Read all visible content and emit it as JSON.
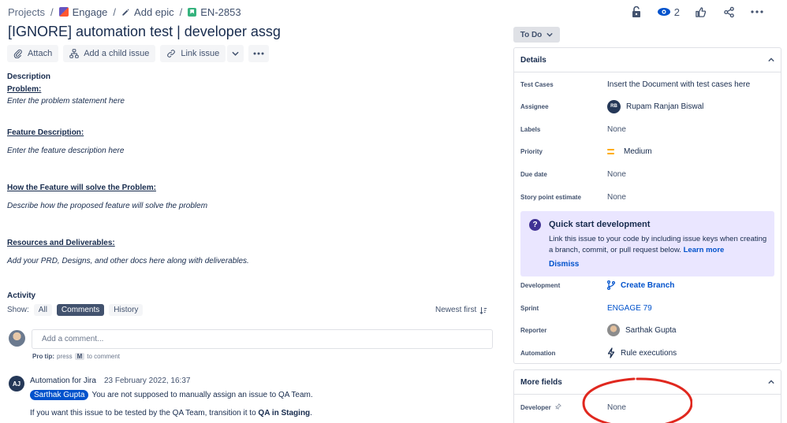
{
  "breadcrumb": {
    "projects": "Projects",
    "project": "Engage",
    "epic": "Add epic",
    "issue_key": "EN-2853"
  },
  "top": {
    "watchers": "2"
  },
  "issue": {
    "title": "[IGNORE] automation test | developer assg"
  },
  "toolbar": {
    "attach": "Attach",
    "add_child": "Add a child issue",
    "link_issue": "Link issue"
  },
  "description": {
    "heading": "Description",
    "sections": [
      {
        "title": "Problem:",
        "body": "Enter the problem statement here"
      },
      {
        "title": "Feature Description:",
        "body": "Enter the feature description here"
      },
      {
        "title": "How the Feature will solve the Problem:",
        "body": "Describe how the proposed feature will solve the problem"
      },
      {
        "title": "Resources and Deliverables:",
        "body": "Add your PRD, Designs, and other docs here along with deliverables."
      }
    ]
  },
  "activity": {
    "title": "Activity",
    "show_label": "Show:",
    "tabs": [
      "All",
      "Comments",
      "History"
    ],
    "sort": "Newest first",
    "add_comment_placeholder": "Add a comment...",
    "protip_prefix": "Pro tip:",
    "protip_press": "press",
    "protip_key": "M",
    "protip_suffix": "to comment"
  },
  "comment": {
    "avatar_initials": "AJ",
    "author": "Automation for Jira",
    "timestamp": "23 February 2022, 16:37",
    "mention": "Sarthak Gupta",
    "line1": "You are not supposed to manually assign an issue to QA Team.",
    "line2_prefix": "If you want this issue to be tested by the QA Team, transition it to ",
    "line2_bold": "QA in Staging",
    "line2_suffix": "."
  },
  "status": {
    "label": "To Do"
  },
  "details": {
    "title": "Details",
    "fields": {
      "test_cases": {
        "label": "Test Cases",
        "value": "Insert the Document with test cases here"
      },
      "assignee": {
        "label": "Assignee",
        "initials": "RB",
        "value": "Rupam Ranjan Biswal"
      },
      "labels": {
        "label": "Labels",
        "value": "None"
      },
      "priority": {
        "label": "Priority",
        "value": "Medium"
      },
      "due_date": {
        "label": "Due date",
        "value": "None"
      },
      "story_points": {
        "label": "Story point estimate",
        "value": "None"
      },
      "development": {
        "label": "Development",
        "value": "Create Branch"
      },
      "sprint": {
        "label": "Sprint",
        "value": "ENGAGE 79"
      },
      "reporter": {
        "label": "Reporter",
        "value": "Sarthak Gupta"
      },
      "automation": {
        "label": "Automation",
        "value": "Rule executions"
      }
    },
    "quick_start": {
      "title": "Quick start development",
      "body": "Link this issue to your code by including issue keys when creating a branch, commit, or pull request below.",
      "learn_more": "Learn more",
      "dismiss": "Dismiss"
    }
  },
  "more_fields": {
    "title": "More fields",
    "developer": {
      "label": "Developer",
      "value": "None"
    }
  },
  "colors": {
    "brand": "#0052cc",
    "annotation": "#e0281f",
    "priority": "#ffab00"
  }
}
